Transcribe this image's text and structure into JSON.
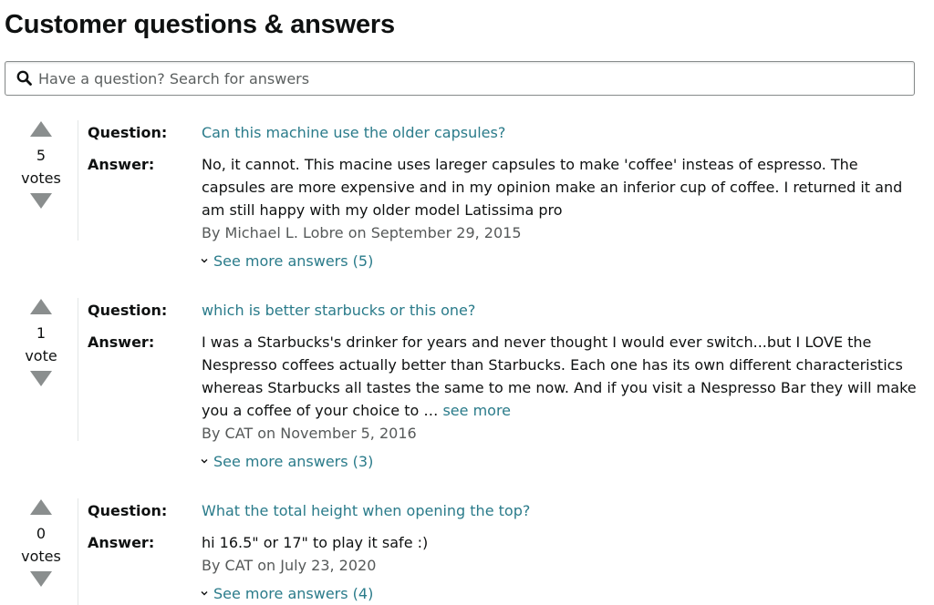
{
  "page": {
    "title": "Customer questions & answers"
  },
  "search": {
    "placeholder": "Have a question? Search for answers",
    "icon": "search-icon"
  },
  "colors": {
    "link": "#2a7b8a",
    "text": "#0f1111",
    "muted": "#565959",
    "arrow": "#8a8e8e"
  },
  "questions": [
    {
      "votes": "5",
      "votes_label": "votes",
      "question_label": "Question:",
      "question": "Can this machine use the older capsules?",
      "answer_label": "Answer:",
      "answer": "No, it cannot. This macine uses lareger capsules to make 'coffee' insteas of espresso. The capsules are more expensive and in my opinion make an inferior cup of coffee. I returned it and am still happy with my older model Latissima pro",
      "answer_see_more": "",
      "byline": "By Michael L. Lobre on September 29, 2015",
      "more_answers": "See more answers (5)"
    },
    {
      "votes": "1",
      "votes_label": "vote",
      "question_label": "Question:",
      "question": "which is better starbucks or this one?",
      "answer_label": "Answer:",
      "answer": "I was a Starbucks's drinker for years and never thought I would ever switch...but I LOVE the Nespresso coffees actually better than Starbucks. Each one has its own different characteristics whereas Starbucks all tastes the same to me now. And if you visit a Nespresso Bar they will make you a coffee of your choice to … ",
      "answer_see_more": "see more",
      "byline": "By CAT on November 5, 2016",
      "more_answers": "See more answers (3)"
    },
    {
      "votes": "0",
      "votes_label": "votes",
      "question_label": "Question:",
      "question": "What the total height when opening the top?",
      "answer_label": "Answer:",
      "answer": "hi 16.5\" or 17\" to play it safe :)",
      "answer_see_more": "",
      "byline": "By CAT on July 23, 2020",
      "more_answers": "See more answers (4)"
    }
  ]
}
